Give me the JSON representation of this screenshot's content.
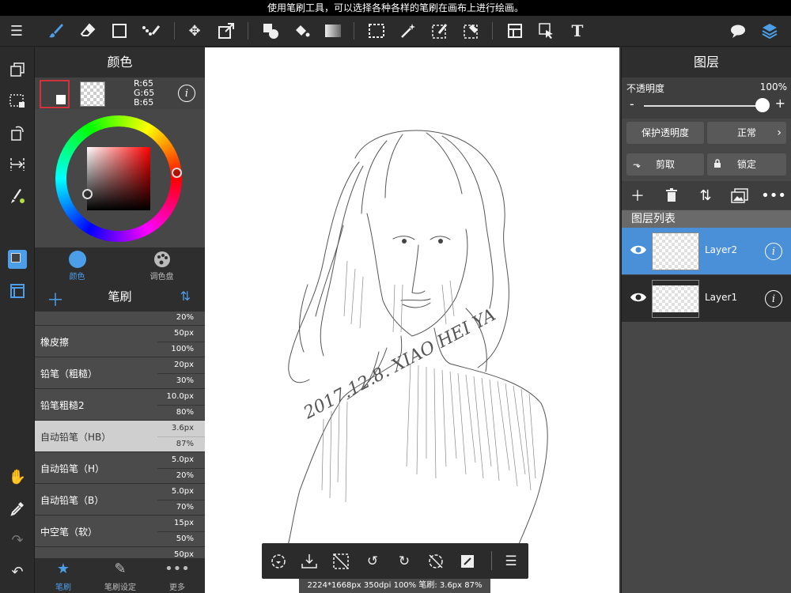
{
  "status_bar": {
    "hint": "使用笔刷工具，可以选择各种各样的笔刷在画布上进行绘画。"
  },
  "toolbar": {
    "tools": [
      "menu-icon",
      "brush-icon",
      "eraser-icon",
      "rectangle-icon",
      "dots-brush-icon",
      "move-icon",
      "transform-icon",
      "shape-fill-icon",
      "bucket-icon",
      "gradient-icon",
      "select-rect-icon",
      "magic-wand-icon",
      "select-pen-icon",
      "select-eraser-icon",
      "frame-icon",
      "operation-icon",
      "text-icon",
      "speech-bubble-icon",
      "layers-icon"
    ]
  },
  "left_tools": [
    "copy-icon",
    "select-dashed-icon",
    "rotate-icon",
    "ruler-icon",
    "brush-color-icon",
    "color-swatch-icon",
    "frame-window-icon",
    "hand-icon",
    "eyedropper-icon",
    "redo-icon",
    "undo-icon"
  ],
  "color_panel": {
    "title": "颜色",
    "current_color": "#414141",
    "rgb": {
      "r": "R:65",
      "g": "G:65",
      "b": "B:65"
    },
    "info_glyph": "i",
    "tabs": [
      {
        "label": "颜色",
        "active": true
      },
      {
        "label": "调色盘",
        "active": false
      }
    ]
  },
  "brush_panel": {
    "title": "笔刷",
    "items": [
      {
        "name": "",
        "size": "",
        "opacity": "20%",
        "selected": false
      },
      {
        "name": "橡皮擦",
        "size": "50px",
        "opacity": "100%",
        "selected": false
      },
      {
        "name": "铅笔（粗糙）",
        "size": "20px",
        "opacity": "30%",
        "selected": false
      },
      {
        "name": "铅笔粗糙2",
        "size": "10.0px",
        "opacity": "80%",
        "selected": false
      },
      {
        "name": "自动铅笔（HB）",
        "size": "3.6px",
        "opacity": "87%",
        "selected": true
      },
      {
        "name": "自动铅笔（H）",
        "size": "5.0px",
        "opacity": "20%",
        "selected": false
      },
      {
        "name": "自动铅笔（B）",
        "size": "5.0px",
        "opacity": "70%",
        "selected": false
      },
      {
        "name": "中空笔（软）",
        "size": "15px",
        "opacity": "50%",
        "selected": false
      },
      {
        "name": "",
        "size": "50px",
        "opacity": "",
        "selected": false
      }
    ],
    "tabs": [
      {
        "label": "笔刷",
        "active": true
      },
      {
        "label": "笔刷设定",
        "active": false
      },
      {
        "label": "更多",
        "active": false
      }
    ]
  },
  "canvas": {
    "signature": "2017.12.8. XIAO HEI YA",
    "status": "2224*1668px 350dpi 100% 笔刷: 3.6px 87%",
    "bottom_bar": [
      "lasso-rotate-icon",
      "save-canvas-icon",
      "clear-selection-icon",
      "undo-rotate-icon",
      "redo-rotate-icon",
      "no-snap-icon",
      "fill-layer-icon",
      "menu-icon"
    ]
  },
  "layer_panel": {
    "title": "图层",
    "opacity_label": "不透明度",
    "opacity_value": "100%",
    "opacity": 1.0,
    "minus": "-",
    "plus": "+",
    "protect_alpha": "保护透明度",
    "blend_mode": "正常",
    "clip": "剪取",
    "lock": "锁定",
    "list_header": "图层列表",
    "layers": [
      {
        "name": "Layer2",
        "selected": true
      },
      {
        "name": "Layer1",
        "selected": false
      }
    ]
  },
  "colors": {
    "accent": "#4a90d9",
    "selected_brush": "#cfcfcf",
    "panel_bg": "#474747"
  }
}
